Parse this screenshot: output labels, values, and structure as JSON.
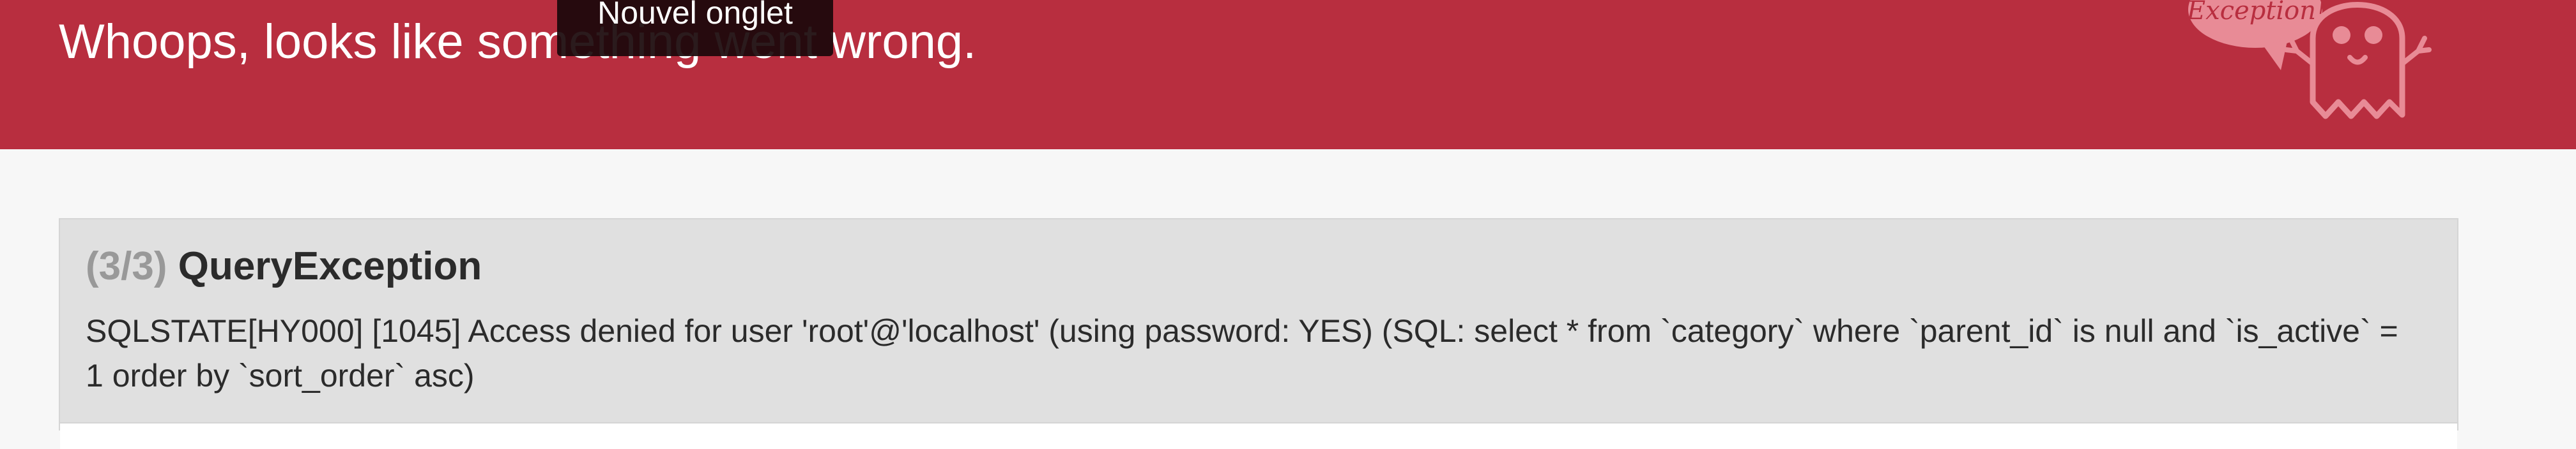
{
  "header": {
    "title": "Whoops, looks like something went wrong.",
    "logo_text": "Exception!",
    "background_color": "#b82e3f"
  },
  "tooltip": {
    "text": "Nouvel onglet"
  },
  "exception": {
    "counter": "(3/3)",
    "class_name": "QueryException",
    "message": "SQLSTATE[HY000] [1045] Access denied for user 'root'@'localhost' (using password: YES) (SQL: select * from `category` where `parent_id` is null and `is_active` = 1 order by `sort_order` asc)"
  }
}
